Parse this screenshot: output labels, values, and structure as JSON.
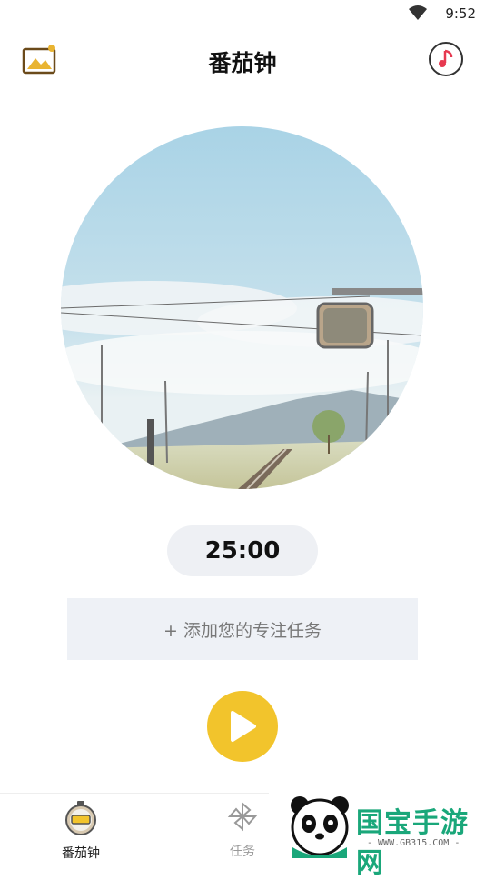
{
  "status_bar": {
    "time": "9:52"
  },
  "header": {
    "title": "番茄钟"
  },
  "timer": {
    "value": "25:00"
  },
  "task": {
    "placeholder": "+ 添加您的专注任务"
  },
  "tabs": [
    {
      "label": "番茄钟",
      "icon": "stopwatch-icon",
      "active": true
    },
    {
      "label": "任务",
      "icon": "pinwheel-icon",
      "active": false
    }
  ],
  "watermark": {
    "text": "国宝手游网",
    "sub": "- WWW.GB315.COM -"
  },
  "colors": {
    "accent": "#f2c42c",
    "timer_bg": "#eef0f4",
    "task_bg": "#eef1f6"
  }
}
